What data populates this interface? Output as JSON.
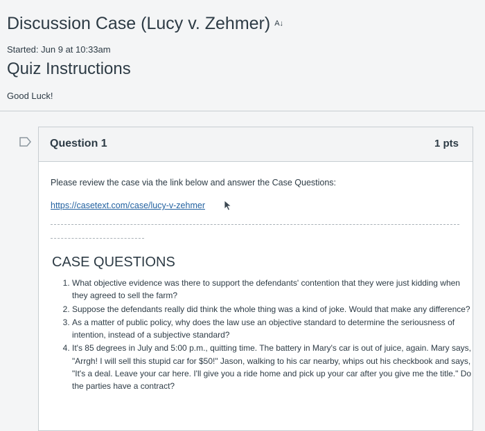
{
  "header": {
    "title": "Discussion Case (Lucy v. Zehmer)",
    "a11y_icon_text": "A↓",
    "started_label": "Started:",
    "started_value": "Jun 9 at 10:33am"
  },
  "instructions": {
    "heading": "Quiz Instructions",
    "text": "Good Luck!"
  },
  "question": {
    "title": "Question 1",
    "points": "1 pts",
    "intro": "Please review the case via the link below and answer the Case Questions:",
    "link": "https://casetext.com/case/lucy-v-zehmer",
    "case_heading": "CASE QUESTIONS",
    "case_questions": [
      "What objective evidence was there to support the defendants' contention that they were just kidding when they agreed to sell the farm?",
      "Suppose the defendants really did think the whole thing was a kind of joke. Would that make any difference?",
      "As a matter of public policy, why does the law use an objective standard to determine the seriousness of intention, instead of a subjective standard?",
      "It's 85 degrees in July and 5:00 p.m., quitting time. The battery in Mary's car is out of juice, again. Mary says, \"Arrgh! I will sell this stupid car for $50!\" Jason, walking to his car nearby, whips out his checkbook and says, \"It's a deal. Leave your car here. I'll give you a ride home and pick up your car after you give me the title.\" Do the parties have a contract?"
    ]
  },
  "icons": {
    "flag": "flag-icon",
    "cursor": "mouse-cursor-icon",
    "a11y": "accessibility-icon"
  },
  "colors": {
    "text": "#2d3b45",
    "link": "#2261a0",
    "header_bg": "#f3f4f5",
    "border": "#c7cdd1"
  }
}
